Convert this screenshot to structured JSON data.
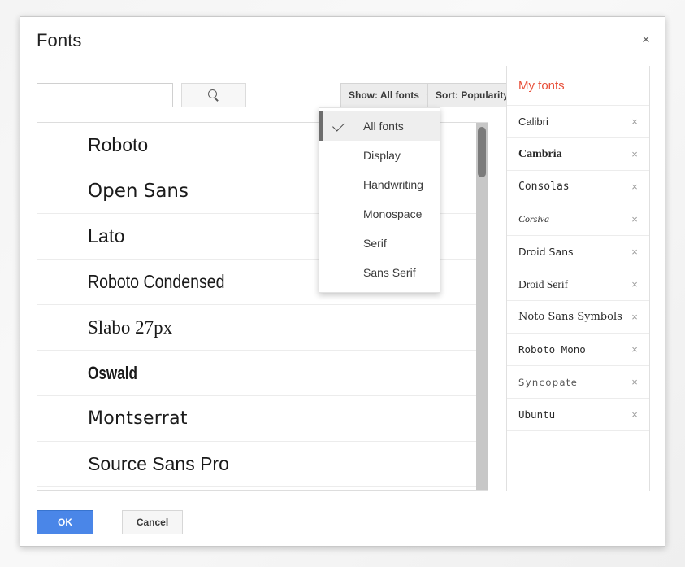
{
  "dialog": {
    "title": "Fonts",
    "close_label": "×"
  },
  "toolbar": {
    "search_value": "",
    "search_placeholder": "",
    "search_button_icon": "search-icon",
    "show_menu_label": "Show: All fonts",
    "sort_menu_label": "Sort: Popularity"
  },
  "dropdown": {
    "open": true,
    "items": [
      {
        "label": "All fonts",
        "selected": true
      },
      {
        "label": "Display",
        "selected": false
      },
      {
        "label": "Handwriting",
        "selected": false
      },
      {
        "label": "Monospace",
        "selected": false
      },
      {
        "label": "Serif",
        "selected": false
      },
      {
        "label": "Sans Serif",
        "selected": false
      }
    ]
  },
  "font_list": {
    "items": [
      {
        "name": "Roboto"
      },
      {
        "name": "Open Sans"
      },
      {
        "name": "Lato"
      },
      {
        "name": "Roboto Condensed"
      },
      {
        "name": "Slabo 27px"
      },
      {
        "name": "Oswald"
      },
      {
        "name": "Montserrat"
      },
      {
        "name": "Source Sans Pro"
      }
    ],
    "scroll_position": "top"
  },
  "my_fonts": {
    "title": "My fonts",
    "title_color": "#e8503a",
    "remove_label": "×",
    "items": [
      {
        "name": "Calibri"
      },
      {
        "name": "Cambria"
      },
      {
        "name": "Consolas"
      },
      {
        "name": "Corsiva"
      },
      {
        "name": "Droid Sans"
      },
      {
        "name": "Droid Serif"
      },
      {
        "name": "Noto Sans Symbols"
      },
      {
        "name": "Roboto Mono"
      },
      {
        "name": "Syncopate"
      },
      {
        "name": "Ubuntu"
      }
    ]
  },
  "footer": {
    "ok_label": "OK",
    "cancel_label": "Cancel",
    "ok_color": "#4a86e8"
  }
}
